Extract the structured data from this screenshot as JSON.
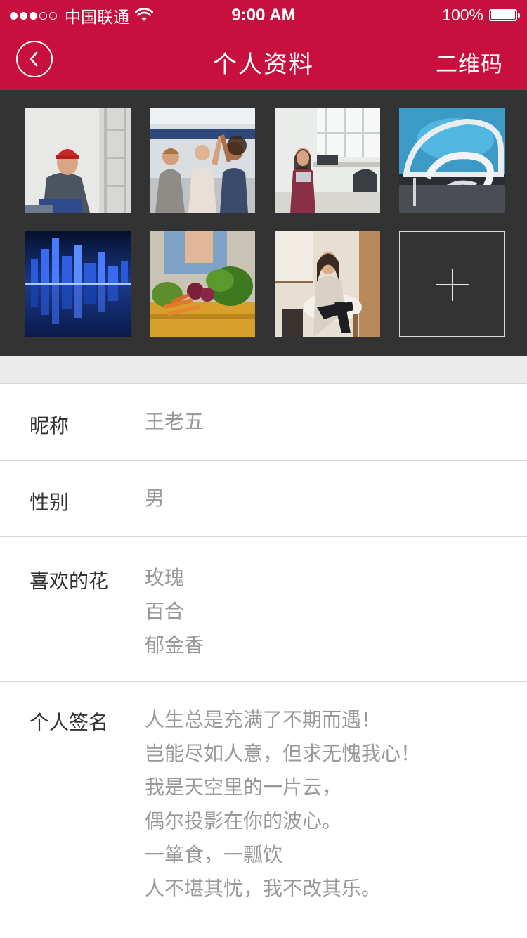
{
  "status_bar": {
    "carrier": "中国联通",
    "time": "9:00 AM",
    "battery": "100%"
  },
  "nav": {
    "title": "个人资料",
    "right_button": "二维码"
  },
  "gallery": {
    "photos": [
      {
        "icon": "man-red-hat-photo"
      },
      {
        "icon": "women-high-five-photo"
      },
      {
        "icon": "woman-office-tablet-photo"
      },
      {
        "icon": "spiral-staircase-photo"
      },
      {
        "icon": "city-night-skyline-photo"
      },
      {
        "icon": "vegetables-box-photo"
      },
      {
        "icon": "smiling-woman-chair-photo"
      }
    ],
    "add_icon": "plus-icon"
  },
  "profile": {
    "nickname": {
      "label": "昵称",
      "value": "王老五"
    },
    "gender": {
      "label": "性别",
      "value": "男"
    },
    "flowers": {
      "label": "喜欢的花",
      "values": [
        "玫瑰",
        "百合",
        "郁金香"
      ]
    },
    "signature": {
      "label": "个人签名",
      "lines": [
        "人生总是充满了不期而遇！",
        "岂能尽如人意，但求无愧我心！",
        "我是天空里的一片云，",
        "偶尔投影在你的波心。",
        "一箪食，一瓢饮",
        "人不堪其忧，我不改其乐。"
      ]
    }
  },
  "colors": {
    "brand": "#c8103e",
    "gallery_bg": "#333333",
    "label_text": "#333333",
    "value_text": "#999999"
  }
}
